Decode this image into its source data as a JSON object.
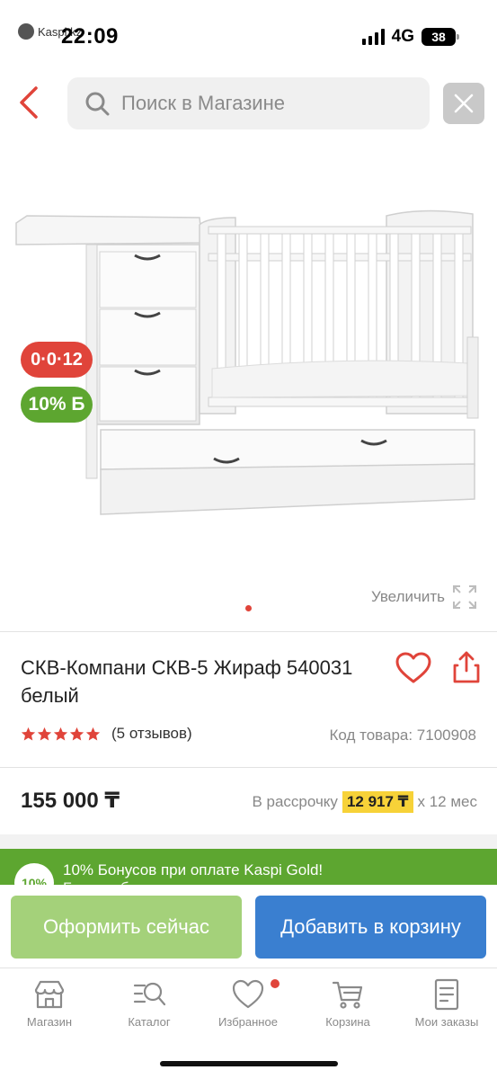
{
  "status_bar": {
    "back_app": "Kaspi.kz",
    "time": "22:09",
    "network": "4G",
    "battery": "38"
  },
  "search": {
    "placeholder": "Поиск в Магазине"
  },
  "product": {
    "badges": {
      "installment": "0·0·12",
      "bonus": "10% Б"
    },
    "zoom_label": "Увеличить",
    "title": "СКВ-Компани СКВ-5 Жираф 540031 белый",
    "rating": 5,
    "reviews": "(5 отзывов)",
    "sku": "Код товара: 7100908",
    "price": "155 000 ₸",
    "installment": {
      "prefix": "В рассрочку",
      "amount": "12 917 ₸",
      "suffix": "х 12 мес"
    }
  },
  "bonus_banner": {
    "badge": "10%",
    "text": "10% Бонусов при оплате Kaspi Gold!",
    "subtext": "Бонусы будут зачислены после получения товара"
  },
  "actions": {
    "buy_now": "Оформить сейчас",
    "add_to_cart": "Добавить в корзину"
  },
  "bottom_nav": {
    "items": [
      {
        "label": "Магазин",
        "icon": "store-icon"
      },
      {
        "label": "Каталог",
        "icon": "catalog-icon"
      },
      {
        "label": "Избранное",
        "icon": "heart-icon"
      },
      {
        "label": "Корзина",
        "icon": "cart-icon"
      },
      {
        "label": "Мои заказы",
        "icon": "orders-icon"
      }
    ]
  },
  "colors": {
    "accent_red": "#e0443a",
    "bonus_green": "#5da630",
    "buy_green": "#a4d17a",
    "cart_blue": "#3a7fd0",
    "installment_yellow": "#f7d238"
  }
}
